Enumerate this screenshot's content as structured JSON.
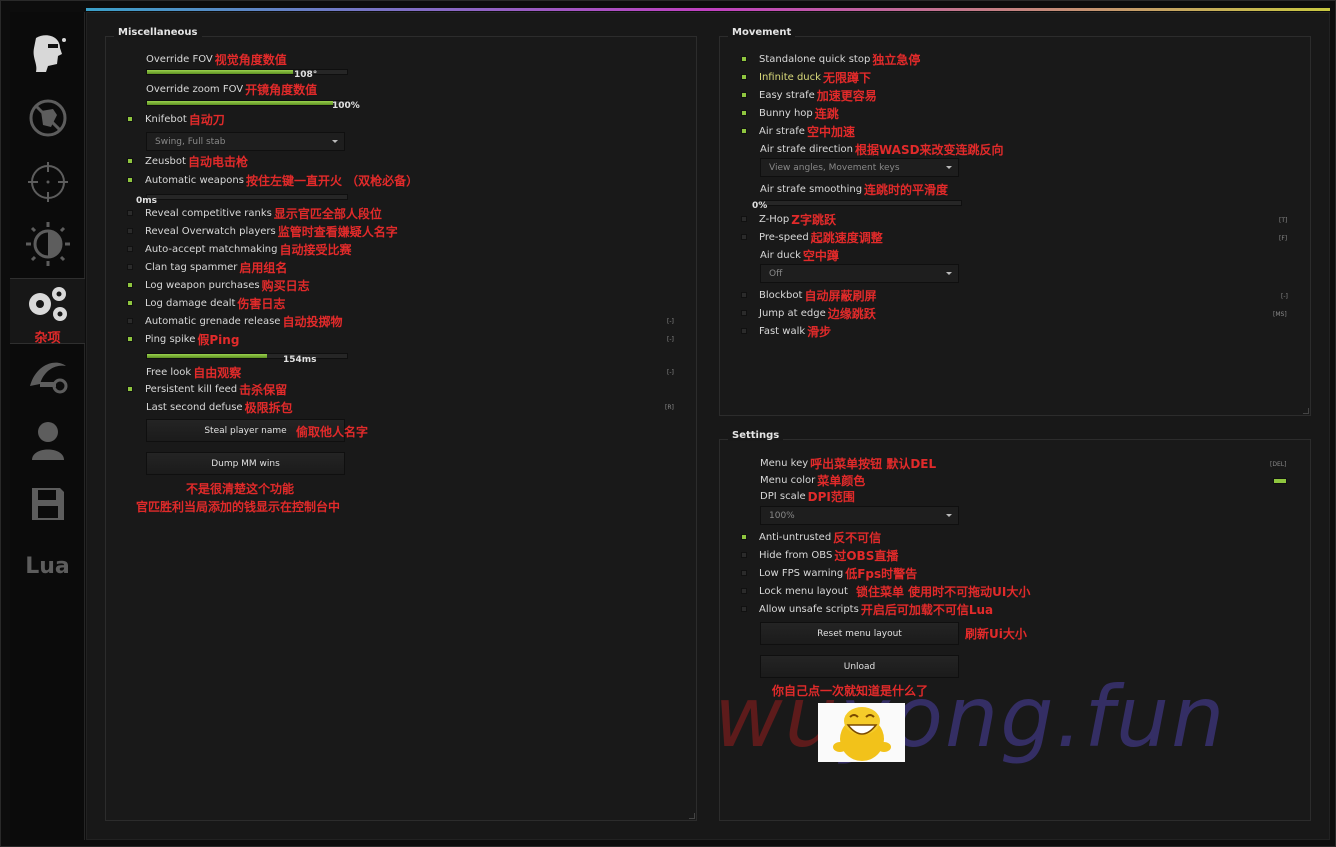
{
  "sidebar": {
    "tabs": [
      {
        "name": "ragebot",
        "icon": "head-target-icon"
      },
      {
        "name": "antiaim",
        "icon": "no-shoot-icon"
      },
      {
        "name": "legit",
        "icon": "crosshair-icon"
      },
      {
        "name": "visuals",
        "icon": "brightness-icon"
      },
      {
        "name": "misc",
        "icon": "gears-icon",
        "label": "杂项",
        "active": true
      },
      {
        "name": "skins",
        "icon": "knife-icon"
      },
      {
        "name": "players",
        "icon": "user-icon"
      },
      {
        "name": "config",
        "icon": "floppy-disk-icon"
      },
      {
        "name": "lua",
        "icon": "lua-text",
        "label": "Lua"
      }
    ]
  },
  "misc": {
    "title": "Miscellaneous",
    "override_fov": {
      "label": "Override FOV",
      "note": "视觉角度数值",
      "value": "108°",
      "fraction": 0.73
    },
    "override_zoom_fov": {
      "label": "Override zoom FOV",
      "note": "开镜角度数值",
      "value": "100%",
      "fraction": 0.93
    },
    "knifebot": {
      "label": "Knifebot",
      "note": "自动刀",
      "checked": true
    },
    "knifebot_mode": "Swing, Full stab",
    "zeusbot": {
      "label": "Zeusbot",
      "note": "自动电击枪",
      "checked": true
    },
    "automatic_weapons": {
      "label": "Automatic weapons",
      "note": "按住左键一直开火 （双枪必备）",
      "checked": true
    },
    "auto_weapons_delay": {
      "value": "0ms",
      "fraction": 0.0
    },
    "reveal_ranks": {
      "label": "Reveal competitive ranks",
      "note": "显示官匹全部人段位",
      "checked": false
    },
    "reveal_overwatch": {
      "label": "Reveal Overwatch players",
      "note": "监管时查看嫌疑人名字",
      "checked": false
    },
    "auto_accept": {
      "label": "Auto-accept matchmaking",
      "note": "自动接受比赛",
      "checked": false
    },
    "clan_tag": {
      "label": "Clan tag spammer",
      "note": "启用组名",
      "checked": false
    },
    "log_purchases": {
      "label": "Log weapon purchases",
      "note": "购买日志",
      "checked": true
    },
    "log_damage": {
      "label": "Log damage dealt",
      "note": "伤害日志",
      "checked": true
    },
    "auto_grenade": {
      "label": "Automatic grenade release",
      "note": "自动投掷物",
      "checked": false,
      "key": "[-]"
    },
    "ping_spike": {
      "label": "Ping spike",
      "note": "假Ping",
      "checked": true,
      "key": "[-]"
    },
    "ping_value": {
      "value": "154ms",
      "fraction": 0.6
    },
    "free_look": {
      "label": "Free look",
      "note": "自由观察",
      "key": "[-]"
    },
    "persistent_killfeed": {
      "label": "Persistent kill feed",
      "note": "击杀保留",
      "checked": true
    },
    "last_second_defuse": {
      "label": "Last second defuse",
      "note": "极限拆包",
      "key": "[R]"
    },
    "steal_name_button": {
      "label": "Steal player name",
      "note": "偷取他人名字"
    },
    "dump_mm_button": {
      "label": "Dump MM wins"
    },
    "dump_note_1": "不是很清楚这个功能",
    "dump_note_2": "官匹胜利当局添加的钱显示在控制台中"
  },
  "movement": {
    "title": "Movement",
    "quick_stop": {
      "label": "Standalone quick stop",
      "note": "独立急停",
      "checked": true
    },
    "infinite_duck": {
      "label": "Infinite duck",
      "note": "无限蹲下",
      "checked": true
    },
    "easy_strafe": {
      "label": "Easy strafe",
      "note": "加速更容易",
      "checked": true
    },
    "bunny_hop": {
      "label": "Bunny hop",
      "note": "连跳",
      "checked": true
    },
    "air_strafe": {
      "label": "Air strafe",
      "note": "空中加速",
      "checked": true
    },
    "air_strafe_direction": {
      "label": "Air strafe direction",
      "note": "根据WASD来改变连跳反向",
      "value": "View angles, Movement keys"
    },
    "air_strafe_smoothing": {
      "label": "Air strafe smoothing",
      "note": "连跳时的平滑度",
      "value": "0%",
      "fraction": 0.0
    },
    "z_hop": {
      "label": "Z-Hop",
      "note": "Z字跳跃",
      "checked": false,
      "key": "[T]"
    },
    "pre_speed": {
      "label": "Pre-speed",
      "note": "起跳速度调整",
      "checked": false,
      "key": "[F]"
    },
    "air_duck": {
      "label": "Air duck",
      "note": "空中蹲",
      "value": "Off"
    },
    "blockbot": {
      "label": "Blockbot",
      "note": "自动屏蔽刷屏",
      "checked": false,
      "key": "[-]"
    },
    "jump_at_edge": {
      "label": "Jump at edge",
      "note": "边缘跳跃",
      "checked": false,
      "key": "[MS]"
    },
    "fast_walk": {
      "label": "Fast walk",
      "note": "滑步",
      "checked": false
    }
  },
  "settings": {
    "title": "Settings",
    "menu_key": {
      "label": "Menu key",
      "note": "呼出菜单按钮 默认DEL",
      "key": "[DEL]"
    },
    "menu_color": {
      "label": "Menu color",
      "note": "菜单颜色",
      "color": "#8fc63f"
    },
    "dpi_scale": {
      "label": "DPI scale",
      "note": "DPI范围",
      "value": "100%"
    },
    "anti_untrusted": {
      "label": "Anti-untrusted",
      "note": "反不可信",
      "checked": true
    },
    "hide_obs": {
      "label": "Hide from OBS",
      "note": "过OBS直播",
      "checked": false
    },
    "low_fps": {
      "label": "Low FPS warning",
      "note": "低Fps时警告",
      "checked": false
    },
    "lock_layout": {
      "label": "Lock menu layout",
      "note": "锁住菜单  使用时不可拖动UI大小",
      "checked": false
    },
    "unsafe_scripts": {
      "label": "Allow unsafe scripts",
      "note": "开启后可加载不可信Lua",
      "checked": false
    },
    "reset_layout_button": {
      "label": "Reset menu layout",
      "note": "刷新Ui大小"
    },
    "unload_button": {
      "label": "Unload",
      "note": "你自己点一次就知道是什么了"
    }
  },
  "watermark": {
    "part1": "wu",
    "part2": "yong",
    "part3": ".fun"
  },
  "colors": {
    "accent": "#8fc63f",
    "annotation": "#e12a2a",
    "background": "#181818"
  }
}
